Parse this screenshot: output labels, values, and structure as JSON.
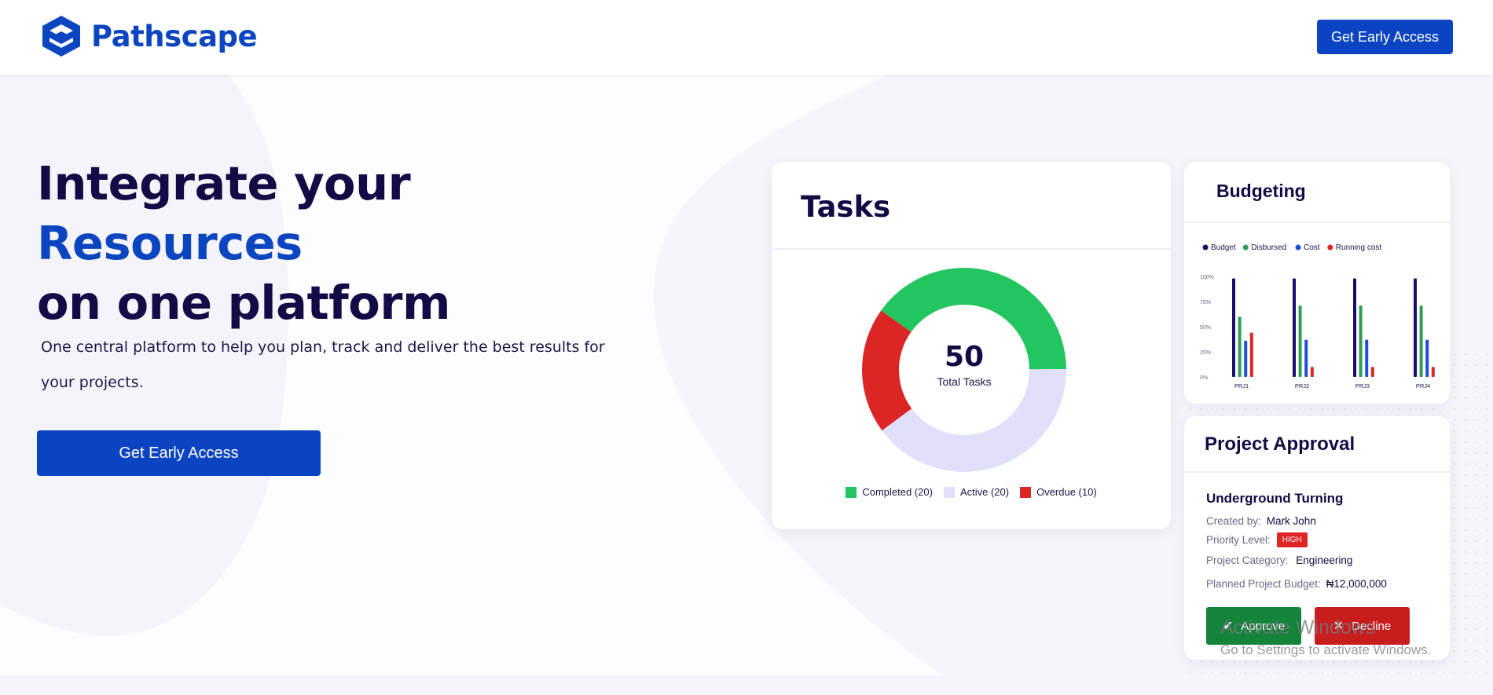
{
  "brand": {
    "name": "Pathscape"
  },
  "header": {
    "cta_label": "Get Early Access"
  },
  "hero": {
    "title_line1": "Integrate your",
    "title_line2": "Resources",
    "title_line3": "on one platform",
    "subtitle": "One central platform to help you plan, track and deliver the best results for your projects.",
    "cta_label": "Get Early Access"
  },
  "tasks_card": {
    "title": "Tasks",
    "total_value": "50",
    "total_label": "Total Tasks",
    "legend": [
      {
        "label": "Completed (20)",
        "color": "#22c55e"
      },
      {
        "label": "Active (20)",
        "color": "#e0e0fa"
      },
      {
        "label": "Overdue (10)",
        "color": "#dc2626"
      }
    ]
  },
  "budget_card": {
    "title": "Budgeting"
  },
  "chart_data": [
    {
      "type": "pie",
      "categories": [
        "Completed",
        "Active",
        "Overdue"
      ],
      "values": [
        20,
        20,
        10
      ],
      "colors": [
        "#22c55e",
        "#e0e0fa",
        "#dc2626"
      ],
      "center_value": "50",
      "center_label": "Total Tasks"
    },
    {
      "type": "bar",
      "categories": [
        "PRJ1",
        "PRJ2",
        "PRJ3",
        "PRJ4"
      ],
      "yticks": [
        "0%",
        "25%",
        "50%",
        "75%",
        "100%"
      ],
      "ylim": [
        0,
        100
      ],
      "legend_position": "top-left",
      "grid": false,
      "series": [
        {
          "name": "Budget",
          "color": "#1e0b6b",
          "values": [
            98,
            98,
            98,
            98
          ]
        },
        {
          "name": "Disbursed",
          "color": "#2f9e55",
          "values": [
            60,
            71,
            71,
            71
          ]
        },
        {
          "name": "Cost",
          "color": "#1d4ed8",
          "values": [
            36,
            37,
            37,
            37
          ]
        },
        {
          "name": "Running cost",
          "color": "#dc2626",
          "values": [
            44,
            10,
            10,
            10
          ]
        }
      ]
    }
  ],
  "approval_card": {
    "title": "Project Approval",
    "project_name": "Underground Turning",
    "created_by_label": "Created by:",
    "created_by_value": "Mark John",
    "priority_label": "Priority Level:",
    "priority_value": "HIGH",
    "category_label": "Project Category:",
    "category_value": "Engineering",
    "budget_label": "Planned Project Budget:",
    "budget_value": "₦12,000,000",
    "approve_label": "Approve",
    "decline_label": "Decline"
  },
  "watermark": {
    "title": "Activate Windows",
    "subtitle": "Go to Settings to activate Windows."
  }
}
